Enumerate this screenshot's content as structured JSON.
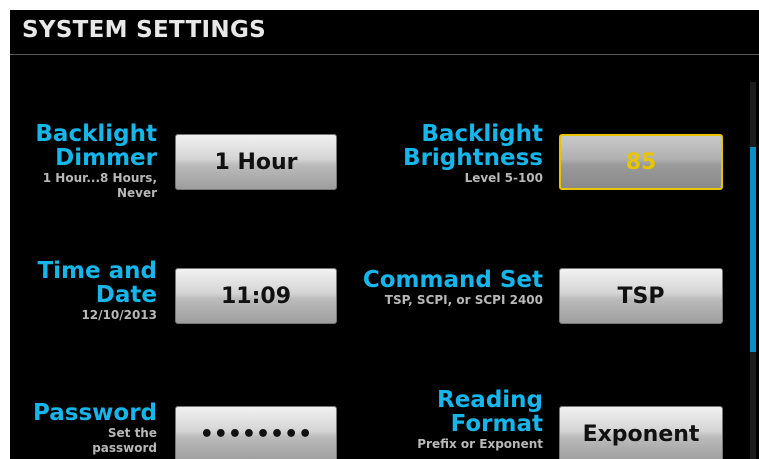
{
  "title": "SYSTEM SETTINGS",
  "settings": [
    {
      "label_lines": [
        "Backlight",
        "Dimmer"
      ],
      "sub_lines": [
        "1 Hour...8 Hours,",
        "Never"
      ],
      "value": "1 Hour"
    },
    {
      "label_lines": [
        "Backlight",
        "Brightness"
      ],
      "sub_lines": [
        "Level 5-100"
      ],
      "value": "85"
    },
    {
      "label_lines": [
        "Time and",
        "Date"
      ],
      "sub_lines": [
        "12/10/2013"
      ],
      "value": "11:09"
    },
    {
      "label_lines": [
        "Command Set"
      ],
      "sub_lines": [
        "TSP, SCPI, or SCPI 2400"
      ],
      "value": "TSP"
    },
    {
      "label_lines": [
        "Password"
      ],
      "sub_lines": [
        "Set the",
        "password"
      ],
      "value": "••••••••"
    },
    {
      "label_lines": [
        "Reading",
        "Format"
      ],
      "sub_lines": [
        "Prefix or Exponent"
      ],
      "value": "Exponent"
    }
  ],
  "scrollbar": {
    "position_fraction": 0.17,
    "visible_fraction": 0.54
  }
}
